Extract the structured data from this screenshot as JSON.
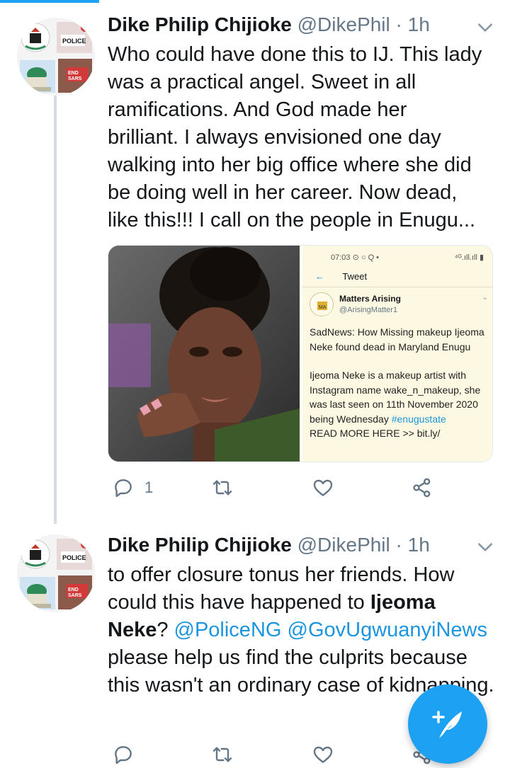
{
  "tweets": [
    {
      "author": {
        "name": "Dike Philip Chijioke",
        "handle": "@DikePhil",
        "separator": "·",
        "time": "1h"
      },
      "text_lines": [
        "Who could have done this to IJ. This lady",
        "was a practical angel. Sweet in all",
        "ramifications. And God made her",
        "brilliant. I always envisioned one day",
        "walking into her big office where she did",
        "be doing well in her career. Now dead,",
        "like this!!! I call on the people in Enugu..."
      ],
      "media": {
        "photo_icon": "portrait-photo",
        "screenshot": {
          "status_time": "07:03",
          "status_icons": "⊙ ○ Q •",
          "status_right": "⁴ᴳ.ıll.ıll ▮",
          "nav_back": "←",
          "nav_title": "Tweet",
          "author_name": "Matters Arising",
          "author_handle": "@ArisingMatter1",
          "headline": "SadNews: How Missing makeup Ijeoma Neke found dead in Maryland Enugu",
          "body": "Ijeoma Neke is a makeup artist with Instagram name wake_n_makeup, she was last seen on 11th November 2020 being Wednesday",
          "hashtag": "#enugustate",
          "cutoff": "READ MORE HERE >> bit.ly/"
        }
      },
      "actions": {
        "reply_count": "1",
        "retweet_count": "",
        "like_count": ""
      }
    },
    {
      "author": {
        "name": "Dike Philip Chijioke",
        "handle": "@DikePhil",
        "separator": "·",
        "time": "1h"
      },
      "text": {
        "part1": "to offer closure tonus her friends. How could this have happened to ",
        "bold_name": "Ijeoma Neke",
        "part2": "? ",
        "mention1": "@PoliceNG",
        "mention2": "@GovUgwuanyiNews",
        "part3": " please help us find the culprits because this wasn't an ordinary case of kidnapping."
      }
    }
  ],
  "colors": {
    "accent": "#1da1f2",
    "link": "#1b95e0",
    "muted": "#657786"
  },
  "fab": {
    "icon": "compose-tweet-icon"
  }
}
